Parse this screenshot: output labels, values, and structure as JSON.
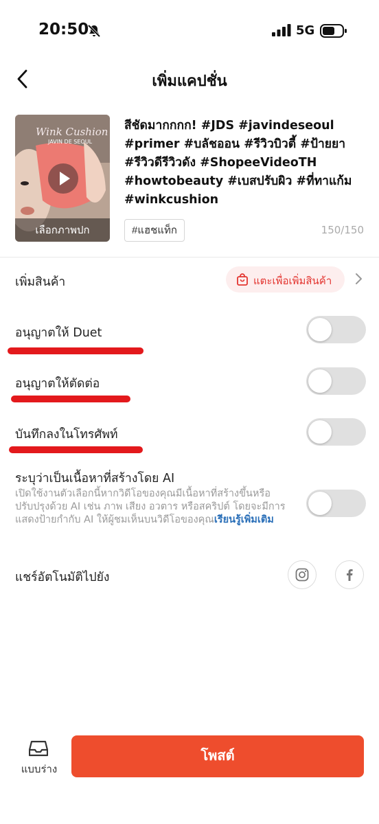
{
  "status_bar": {
    "time": "20:50",
    "network": "5G"
  },
  "header": {
    "title": "เพิ่มแคปชั่น"
  },
  "video": {
    "cover_label": "เลือกภาพปก",
    "caption": "สีชัดมากกกก! #JDS #javindeseoul #primer #บลัชออน #รีวิวบิวตี้ #ป้ายยา #รีวิวดีรีวิวดัง #ShopeeVideoTH #howtobeauty #เบสปรับผิว #ที่ทาแก้ม #winkcushion",
    "hashtag_button": "#แฮชแท็ก",
    "char_count": "150/150"
  },
  "add_product": {
    "label": "เพิ่มสินค้า",
    "button": "แตะเพื่อเพิ่มสินค้า"
  },
  "settings": {
    "allow_duet": {
      "label": "อนุญาตให้ Duet",
      "on": false
    },
    "allow_stitch": {
      "label": "อนุญาตให้ตัดต่อ",
      "on": false
    },
    "save_to_phone": {
      "label": "บันทึกลงในโทรศัพท์",
      "on": false
    },
    "ai_content": {
      "label": "ระบุว่าเป็นเนื้อหาที่สร้างโดย AI",
      "description": "เปิดใช้งานตัวเลือกนี้หากวิดีโอของคุณมีเนื้อหาที่สร้างขึ้นหรือปรับปรุงด้วย AI เช่น ภาพ เสียง อวตาร หรือสคริปต์ โดยจะมีการแสดงป้ายกำกับ AI ให้ผู้ชมเห็นบนวิดีโอของคุณ",
      "link": "เรียนรู้เพิ่มเติม",
      "on": false
    }
  },
  "auto_share": {
    "label": "แชร์อัตโนมัติไปยัง",
    "icons": [
      "instagram-icon",
      "facebook-icon"
    ]
  },
  "bottom": {
    "drafts_label": "แบบร่าง",
    "post_label": "โพสต์"
  },
  "colors": {
    "accent": "#ee4d2d",
    "annotation_red": "#e3191c",
    "link_blue": "#2a6fb8"
  }
}
